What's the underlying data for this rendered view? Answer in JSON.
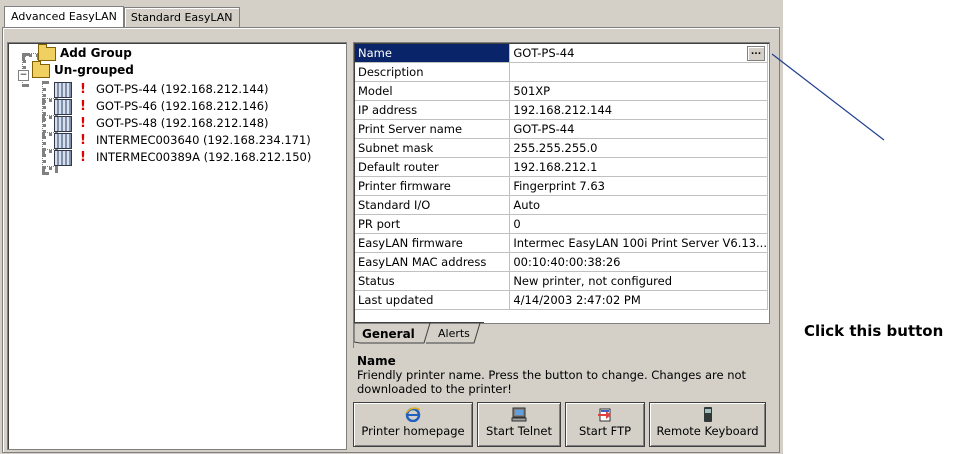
{
  "top_tabs": [
    "Advanced EasyLAN",
    "Standard EasyLAN"
  ],
  "tree": {
    "add_group": "Add Group",
    "ungrouped": "Un-grouped",
    "printers": [
      "GOT-PS-44 (192.168.212.144)",
      "GOT-PS-46 (192.168.212.146)",
      "GOT-PS-48 (192.168.212.148)",
      "INTERMEC003640 (192.168.234.171)",
      "INTERMEC00389A (192.168.212.150)"
    ],
    "warning_mark": "!"
  },
  "properties": [
    {
      "key": "Name",
      "value": "GOT-PS-44"
    },
    {
      "key": "Description",
      "value": ""
    },
    {
      "key": "Model",
      "value": "501XP"
    },
    {
      "key": "IP address",
      "value": "192.168.212.144"
    },
    {
      "key": "Print Server name",
      "value": "GOT-PS-44"
    },
    {
      "key": "Subnet mask",
      "value": "255.255.255.0"
    },
    {
      "key": "Default router",
      "value": "192.168.212.1"
    },
    {
      "key": "Printer firmware",
      "value": "Fingerprint    7.63"
    },
    {
      "key": "Standard I/O",
      "value": "Auto"
    },
    {
      "key": "PR port",
      "value": "0"
    },
    {
      "key": "EasyLAN firmware",
      "value": "Intermec EasyLAN 100i Print Server V6.13..."
    },
    {
      "key": "EasyLAN MAC address",
      "value": "00:10:40:00:38:26"
    },
    {
      "key": "Status",
      "value": "New printer, not configured"
    },
    {
      "key": "Last updated",
      "value": "4/14/2003 2:47:02 PM"
    }
  ],
  "ellipsis_label": "...",
  "inner_tabs": [
    "General",
    "Alerts"
  ],
  "description": {
    "title": "Name",
    "body": "Friendly printer name. Press the button to change. Changes are not downloaded to the printer!"
  },
  "buttons": [
    "Printer homepage",
    "Start Telnet",
    "Start FTP",
    "Remote Keyboard"
  ],
  "icons": [
    "folder-icon",
    "printer-icon",
    "browser-icon",
    "telnet-icon",
    "ftp-icon",
    "keyboard-icon"
  ],
  "annotation": "Click this button",
  "colors": {
    "selection": "#0a246a",
    "window": "#d4d0c8",
    "warning": "#e00000",
    "callout_line": "#1f3f8f"
  }
}
